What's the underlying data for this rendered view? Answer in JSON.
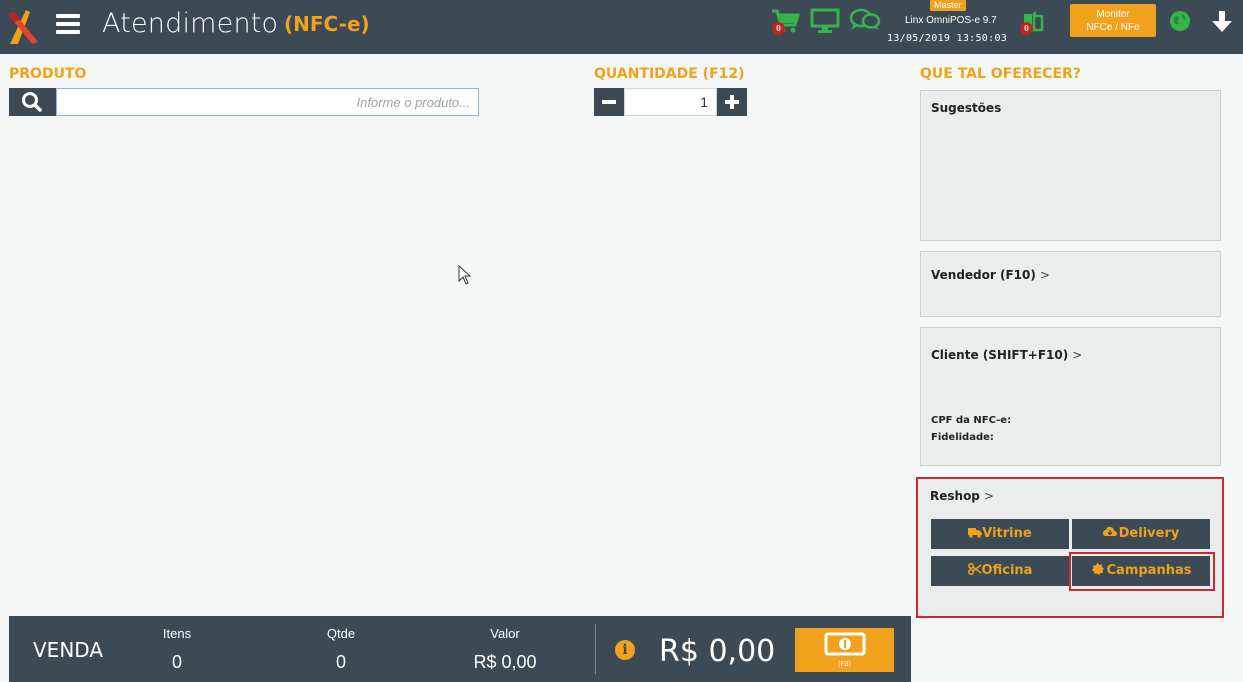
{
  "header": {
    "title": "Atendimento",
    "subtitle": "(NFC-e)",
    "cart_badge": "0",
    "sync_badge": "0",
    "master_tag": "Master",
    "system_name": "Linx OmniPOS-e  9.7",
    "datetime": "13/05/2019 13:50:03",
    "monitor_line1": "Monitor",
    "monitor_line2": "NFCe / NFe"
  },
  "produto": {
    "label": "PRODUTO",
    "placeholder": "Informe o produto..."
  },
  "quantidade": {
    "label": "QUANTIDADE (F12)",
    "value": "1"
  },
  "sidebar": {
    "heading": "QUE TAL OFERECER?",
    "sugestoes": "Sugestões",
    "vendedor": "Vendedor (F10)",
    "cliente": "Cliente (SHIFT+F10)",
    "cpf_label": "CPF da NFC-e:",
    "fidelidade_label": "Fidelidade:",
    "chevron": ">",
    "reshop": {
      "title": "Reshop",
      "buttons": [
        "Vitrine",
        "Delivery",
        "Oficina",
        "Campanhas"
      ]
    }
  },
  "footer": {
    "venda": "VENDA",
    "itens_label": "Itens",
    "itens_value": "0",
    "qtde_label": "Qtde",
    "qtde_value": "0",
    "valor_label": "Valor",
    "valor_value": "R$ 0,00",
    "total": "R$ 0,00",
    "pay_hint": "(F3)"
  },
  "colors": {
    "accent": "#f0a21c",
    "bar": "#3b4a54",
    "highlight": "#d12730"
  }
}
